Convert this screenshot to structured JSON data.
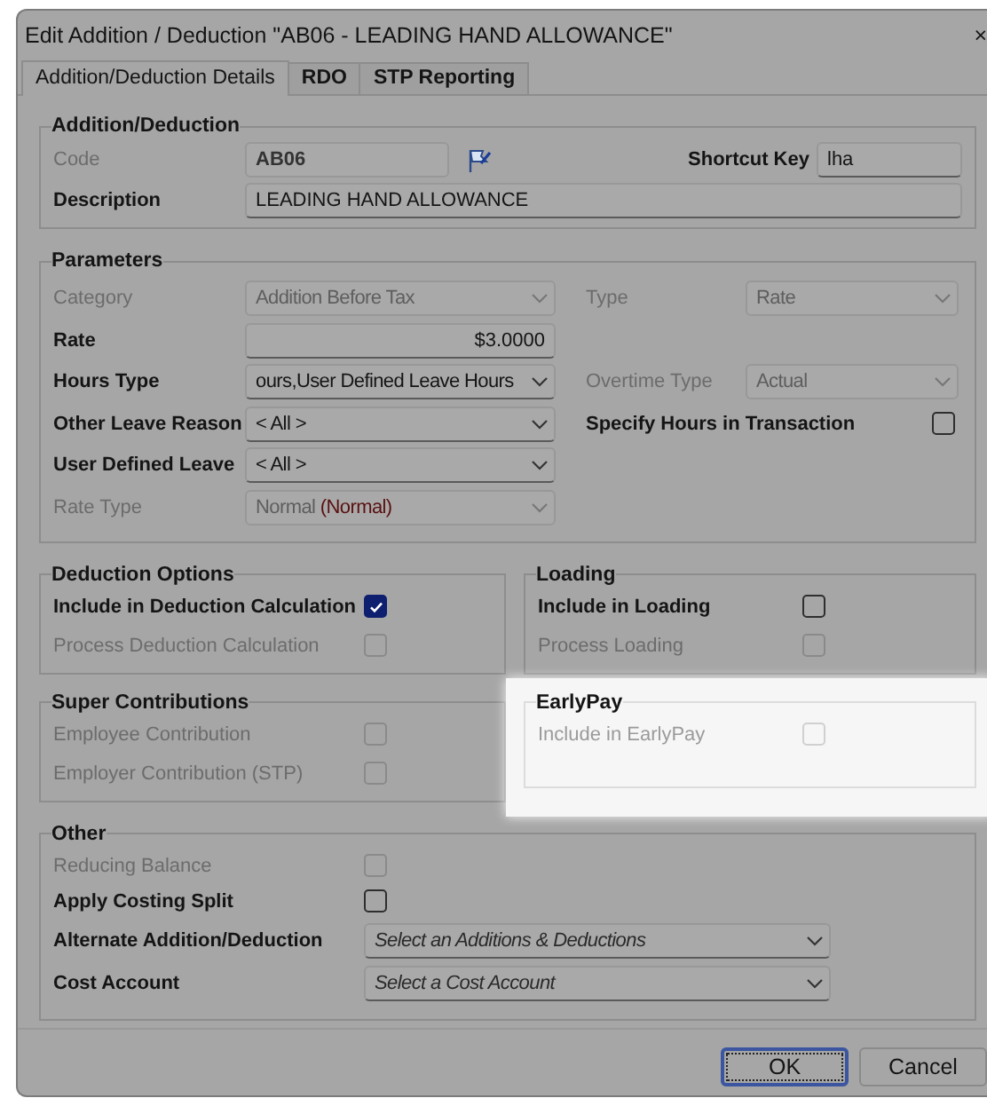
{
  "window": {
    "title": "Edit Addition / Deduction \"AB06 - LEADING HAND ALLOWANCE\"",
    "close": "×"
  },
  "tabs": [
    {
      "label": "Addition/Deduction Details",
      "selected": true
    },
    {
      "label": "RDO",
      "selected": false
    },
    {
      "label": "STP Reporting",
      "selected": false
    }
  ],
  "addition_deduction": {
    "title": "Addition/Deduction",
    "code": {
      "label": "Code",
      "disabled": true,
      "kind": "text",
      "value": "AB06"
    },
    "shortcut_key": {
      "label": "Shortcut Key",
      "disabled": false,
      "kind": "text",
      "value": "lha"
    },
    "description": {
      "label": "Description",
      "disabled": false,
      "kind": "text",
      "value": "LEADING HAND ALLOWANCE"
    }
  },
  "parameters": {
    "title": "Parameters",
    "rows": [
      {
        "left": {
          "label": "Category",
          "disabled": true,
          "kind": "dropdown",
          "value": "Addition Before Tax"
        },
        "right": {
          "label": "Type",
          "disabled": true,
          "kind": "dropdown",
          "value": "Rate"
        }
      },
      {
        "left": {
          "label": "Rate",
          "disabled": false,
          "kind": "amount",
          "value": "$3.0000"
        }
      },
      {
        "left": {
          "label": "Hours Type",
          "disabled": false,
          "kind": "dropdown",
          "value": "ours,User Defined Leave Hours"
        },
        "right": {
          "label": "Overtime Type",
          "disabled": true,
          "kind": "dropdown",
          "value": "Actual"
        }
      },
      {
        "left": {
          "label": "Other Leave Reason",
          "disabled": false,
          "kind": "dropdown",
          "value": "< All >"
        },
        "right": {
          "label": "Specify Hours in Transaction",
          "disabled": false,
          "kind": "checkbox",
          "checked": false
        }
      },
      {
        "left": {
          "label": "User Defined Leave",
          "disabled": false,
          "kind": "dropdown",
          "value": "< All >"
        }
      },
      {
        "left": {
          "label": "Rate Type",
          "disabled": true,
          "kind": "dropdown",
          "value": "Normal",
          "note": "(Normal)"
        }
      }
    ]
  },
  "deduction_options": {
    "title": "Deduction Options",
    "items": [
      {
        "label": "Include in Deduction Calculation",
        "disabled": false,
        "checked": true
      },
      {
        "label": "Process Deduction Calculation",
        "disabled": true,
        "checked": false
      }
    ]
  },
  "loading": {
    "title": "Loading",
    "items": [
      {
        "label": "Include in Loading",
        "disabled": false,
        "checked": false
      },
      {
        "label": "Process Loading",
        "disabled": true,
        "checked": false
      }
    ]
  },
  "super_contributions": {
    "title": "Super Contributions",
    "items": [
      {
        "label": "Employee Contribution",
        "disabled": true,
        "checked": false
      },
      {
        "label": "Employer Contribution (STP)",
        "disabled": true,
        "checked": false
      }
    ]
  },
  "early_pay": {
    "title": "EarlyPay",
    "highlighted": true,
    "items": [
      {
        "label": "Include in EarlyPay",
        "disabled": true,
        "checked": false
      }
    ]
  },
  "other": {
    "title": "Other",
    "rows": [
      {
        "label": "Reducing Balance",
        "disabled": true,
        "kind": "checkbox",
        "checked": false
      },
      {
        "label": "Apply Costing Split",
        "disabled": false,
        "kind": "checkbox",
        "checked": false
      },
      {
        "label": "Alternate Addition/Deduction",
        "disabled": false,
        "kind": "dropdown",
        "placeholder": "Select an Additions & Deductions"
      },
      {
        "label": "Cost Account",
        "disabled": false,
        "kind": "dropdown",
        "placeholder": "Select a Cost Account"
      }
    ]
  },
  "buttons": [
    {
      "label": "OK",
      "default": true
    },
    {
      "label": "Cancel",
      "default": false
    }
  ]
}
